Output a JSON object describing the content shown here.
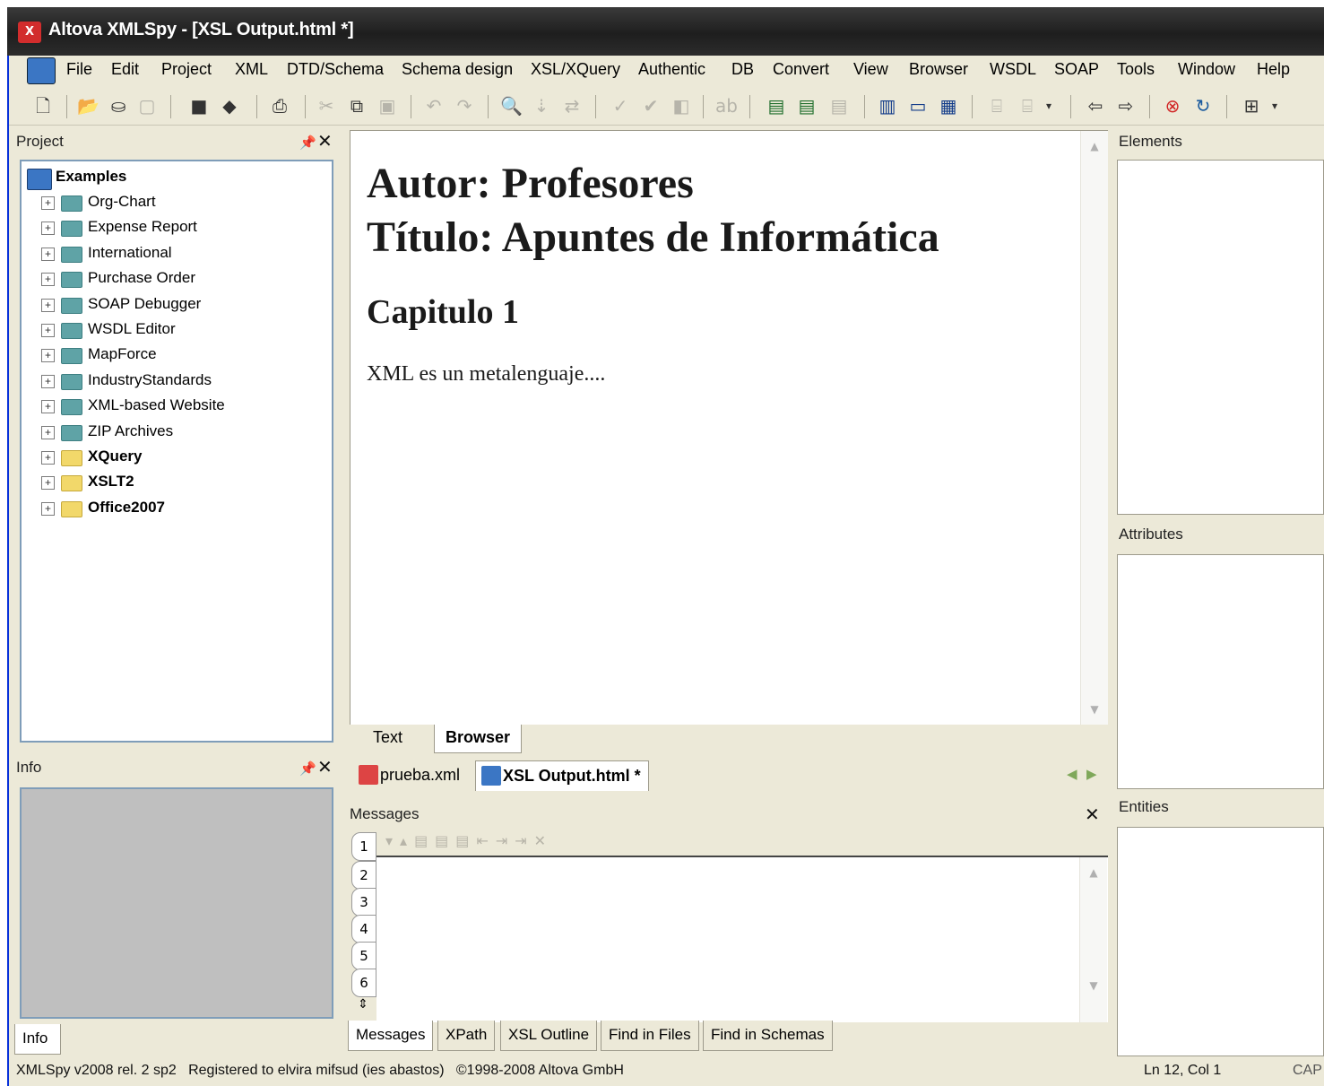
{
  "window": {
    "title": "Altova XMLSpy - [XSL Output.html *]"
  },
  "menubar": [
    "File",
    "Edit",
    "Project",
    "XML",
    "DTD/Schema",
    "Schema design",
    "XSL/XQuery",
    "Authentic",
    "DB",
    "Convert",
    "View",
    "Browser",
    "WSDL",
    "SOAP",
    "Tools",
    "Window",
    "Help"
  ],
  "project_panel": {
    "title": "Project",
    "root": "Examples",
    "items": [
      {
        "label": "Org-Chart",
        "bold": false
      },
      {
        "label": "Expense Report",
        "bold": false
      },
      {
        "label": "International",
        "bold": false
      },
      {
        "label": "Purchase Order",
        "bold": false
      },
      {
        "label": "SOAP Debugger",
        "bold": false
      },
      {
        "label": "WSDL Editor",
        "bold": false
      },
      {
        "label": "MapForce",
        "bold": false
      },
      {
        "label": "IndustryStandards",
        "bold": false
      },
      {
        "label": "XML-based Website",
        "bold": false
      },
      {
        "label": "ZIP Archives",
        "bold": false
      },
      {
        "label": "XQuery",
        "bold": true
      },
      {
        "label": "XSLT2",
        "bold": true
      },
      {
        "label": "Office2007",
        "bold": true
      }
    ]
  },
  "info_panel": {
    "title": "Info",
    "tab": "Info"
  },
  "document": {
    "line1": "Autor: Profesores",
    "line2": "Título: Apuntes de Informática",
    "heading": "Capitulo 1",
    "paragraph": "XML es un metalenguaje....",
    "view_tabs": [
      "Text",
      "Browser"
    ],
    "active_view": "Browser",
    "file_tabs": [
      "prueba.xml",
      "XSL Output.html *"
    ],
    "active_file": "XSL Output.html *"
  },
  "messages": {
    "title": "Messages",
    "side_tabs": [
      "1",
      "2",
      "3",
      "4",
      "5",
      "6"
    ],
    "bottom_tabs": [
      "Messages",
      "XPath",
      "XSL Outline",
      "Find in Files",
      "Find in Schemas"
    ]
  },
  "right_panels": {
    "elements": "Elements",
    "attributes": "Attributes",
    "entities": "Entities"
  },
  "status": {
    "left": "XMLSpy v2008 rel. 2 sp2   Registered to elvira mifsud (ies abastos)   ©1998-2008 Altova GmbH",
    "position": "Ln 12, Col 1",
    "caps": "CAP"
  }
}
